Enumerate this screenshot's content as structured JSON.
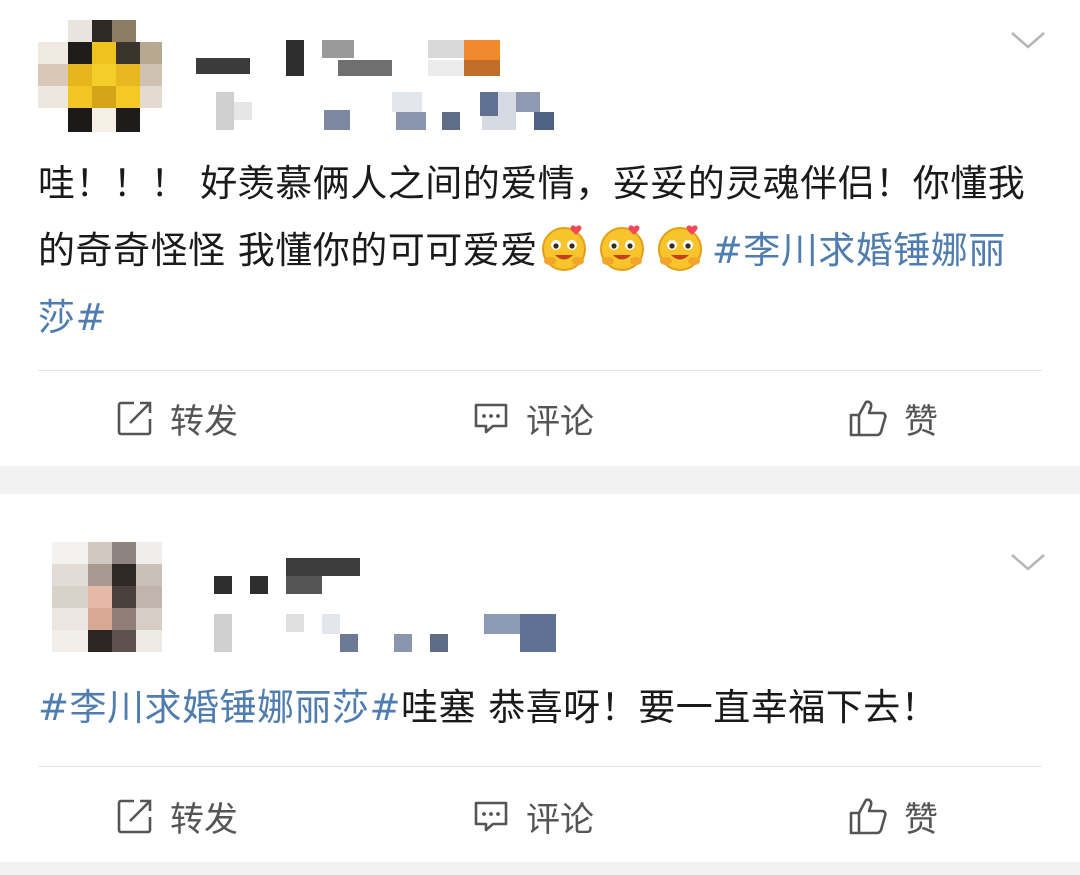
{
  "posts": [
    {
      "content_text": "哇！！！ 好羡慕俩人之间的爱情，妥妥的灵魂伴侣！你懂我的奇奇怪怪 我懂你的可可爱爱",
      "emojis": [
        "smile-hug-emoji",
        "smile-hug-emoji",
        "smile-hug-emoji"
      ],
      "hashtag_after": "#李川求婚锤娜丽莎#",
      "actions": {
        "repost": "转发",
        "comment": "评论",
        "like": "赞"
      }
    },
    {
      "hashtag_before": "#李川求婚锤娜丽莎#",
      "content_text": "哇塞 恭喜呀！要一直幸福下去！",
      "actions": {
        "repost": "转发",
        "comment": "评论",
        "like": "赞"
      }
    }
  ],
  "colors": {
    "hashtag": "#507daf",
    "text": "#1a1a1a",
    "action_text": "#555555",
    "separator": "#f2f2f2"
  },
  "icons": {
    "menu": "chevron-down-icon",
    "repost": "edit-square-icon",
    "comment": "comment-bubble-icon",
    "like": "thumbs-up-icon"
  }
}
